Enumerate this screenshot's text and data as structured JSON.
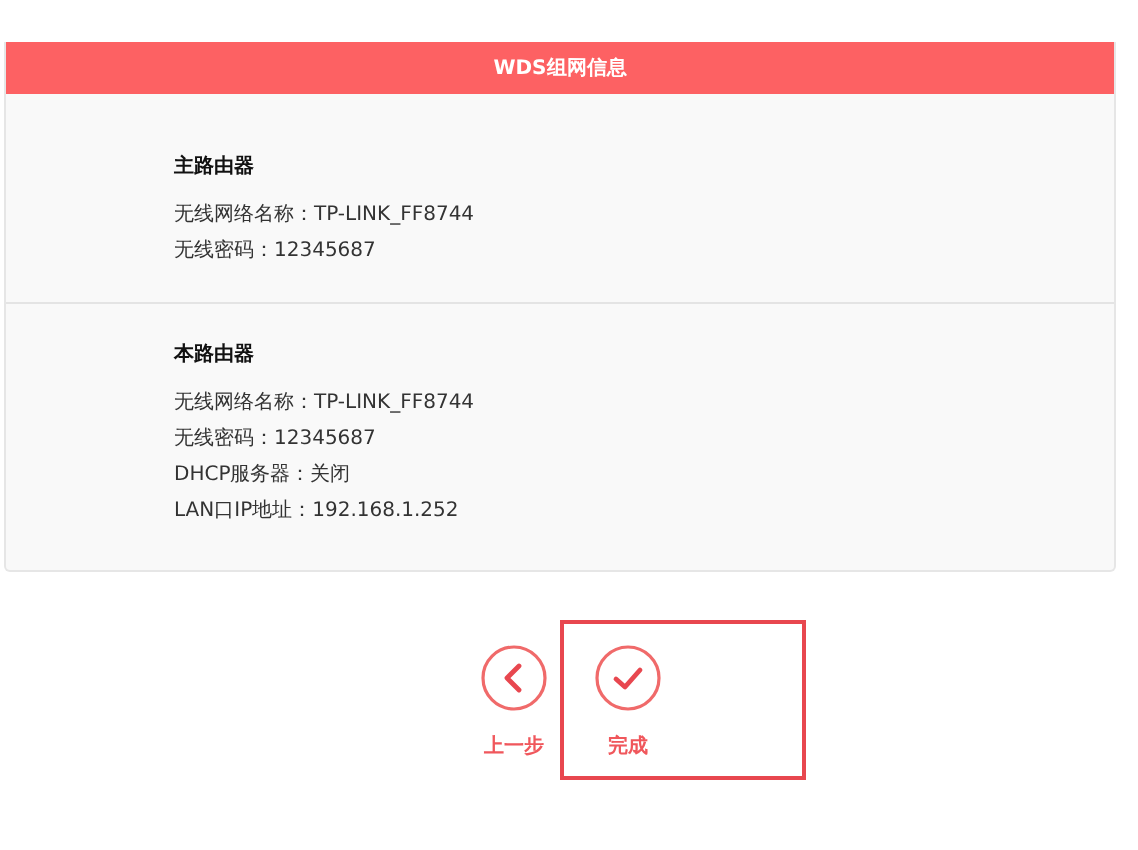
{
  "header": {
    "title": "WDS组网信息"
  },
  "sections": [
    {
      "title": "主路由器",
      "lines": [
        "无线网络名称：TP-LINK_FF8744",
        "无线密码：12345687"
      ]
    },
    {
      "title": "本路由器",
      "lines": [
        "无线网络名称：TP-LINK_FF8744",
        "无线密码：12345687",
        "DHCP服务器：关闭",
        "LAN口IP地址：192.168.1.252"
      ]
    }
  ],
  "buttons": [
    {
      "kind": "back",
      "label": "上一步",
      "highlighted": false
    },
    {
      "kind": "finish",
      "label": "完成",
      "highlighted": true
    }
  ]
}
